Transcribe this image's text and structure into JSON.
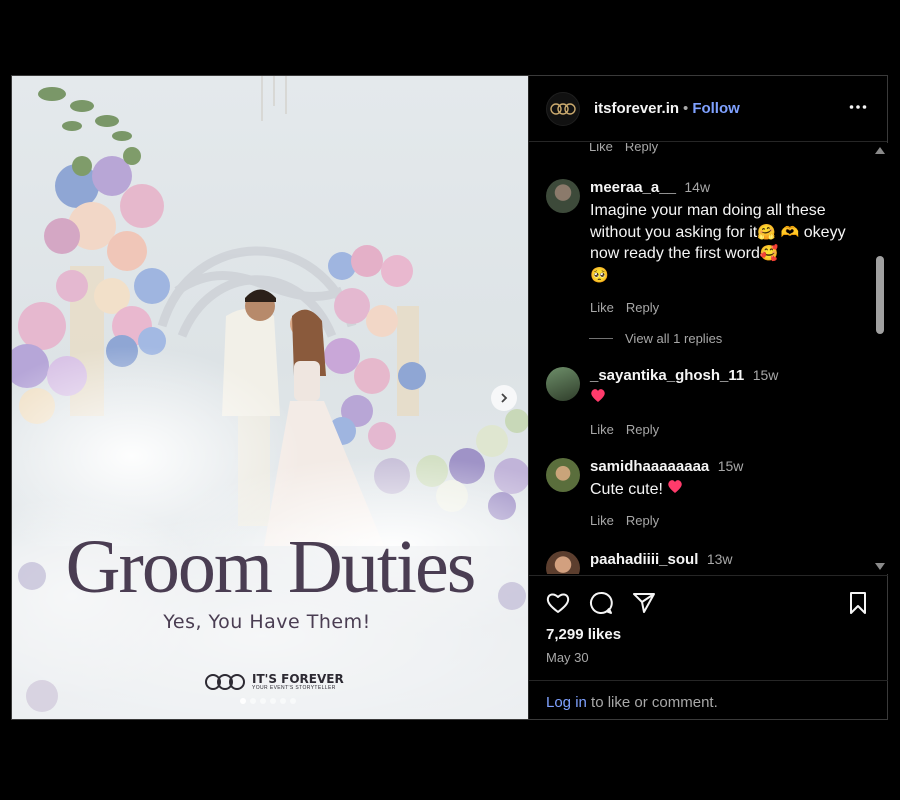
{
  "post": {
    "headline": "Groom Duties",
    "tagline": "Yes, You Have Them!",
    "brand_name": "IT'S FOREVER",
    "brand_subtitle": "YOUR EVENT'S STORYTELLER",
    "carousel": {
      "count": 6,
      "active_index": 0
    }
  },
  "header": {
    "username": "itsforever.in",
    "separator": "•",
    "follow_label": "Follow"
  },
  "comments": {
    "top_actions": {
      "like": "Like",
      "reply": "Reply"
    },
    "items": [
      {
        "username": "meeraa_a__",
        "time": "14w",
        "text_1": "Imagine your man doing all these without you asking for it",
        "emoji_1": "🤗 🫶",
        "text_2": "okeyy now ready the first word",
        "emoji_2": "🥰",
        "emoji_3": "🥺",
        "like": "Like",
        "reply": "Reply",
        "view_replies": "View all 1 replies"
      },
      {
        "username": "_sayantika_ghosh_11",
        "time": "15w",
        "text": "",
        "emoji": "❤️",
        "like": "Like",
        "reply": "Reply"
      },
      {
        "username": "samidhaaaaaaaa",
        "time": "15w",
        "text": "Cute cute!",
        "emoji": "❤️",
        "like": "Like",
        "reply": "Reply"
      },
      {
        "username": "paahadiiii_soul",
        "time": "13w"
      }
    ]
  },
  "actions": {
    "likes": "7,299 likes",
    "date": "May 30",
    "login_link": "Log in",
    "login_rest": " to like or comment."
  },
  "colors": {
    "accent_link": "#7fa1ff",
    "heart": "#ff3b6b",
    "headline": "#4a3d52"
  },
  "icons": [
    "more-options-icon",
    "heart-icon",
    "comment-icon",
    "share-icon",
    "bookmark-icon",
    "chevron-right-icon"
  ]
}
